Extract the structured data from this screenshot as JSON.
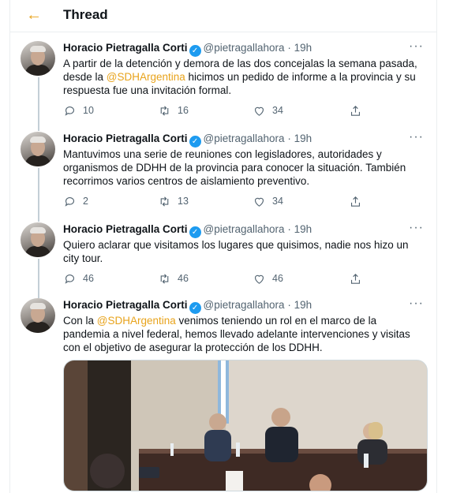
{
  "header": {
    "title": "Thread"
  },
  "colors": {
    "accent": "#e8a31b",
    "verified": "#1d9bf0",
    "muted": "#536471"
  },
  "author": {
    "name": "Horacio Pietragalla Corti",
    "handle": "@pietragallahora"
  },
  "tweets": [
    {
      "time": "19h",
      "text_parts": [
        {
          "t": "A partir de la detención y demora de las dos concejalas la semana pasada, desde la ",
          "m": false
        },
        {
          "t": "@SDHArgentina",
          "m": true
        },
        {
          "t": " hicimos un pedido de informe a la provincia y su respuesta fue una invitación formal.",
          "m": false
        }
      ],
      "replies": "10",
      "retweets": "16",
      "likes": "34"
    },
    {
      "time": "19h",
      "text_parts": [
        {
          "t": "Mantuvimos una serie de reuniones con legisladores, autoridades y organismos de DDHH de la provincia para conocer la situación. También recorrimos varios centros de aislamiento preventivo.",
          "m": false
        }
      ],
      "replies": "2",
      "retweets": "13",
      "likes": "34"
    },
    {
      "time": "19h",
      "text_parts": [
        {
          "t": "Quiero aclarar que visitamos los lugares que quisimos, nadie nos hizo un city tour.",
          "m": false
        }
      ],
      "replies": "46",
      "retweets": "46",
      "likes": "46"
    },
    {
      "time": "19h",
      "text_parts": [
        {
          "t": "Con la ",
          "m": false
        },
        {
          "t": "@SDHArgentina",
          "m": true
        },
        {
          "t": " venimos teniendo un rol en el marco de la pandemia a nivel federal, hemos llevado adelante intervenciones y visitas con el objetivo de asegurar la protección de los DDHH.",
          "m": false
        }
      ],
      "replies": "",
      "retweets": "",
      "likes": ""
    }
  ]
}
